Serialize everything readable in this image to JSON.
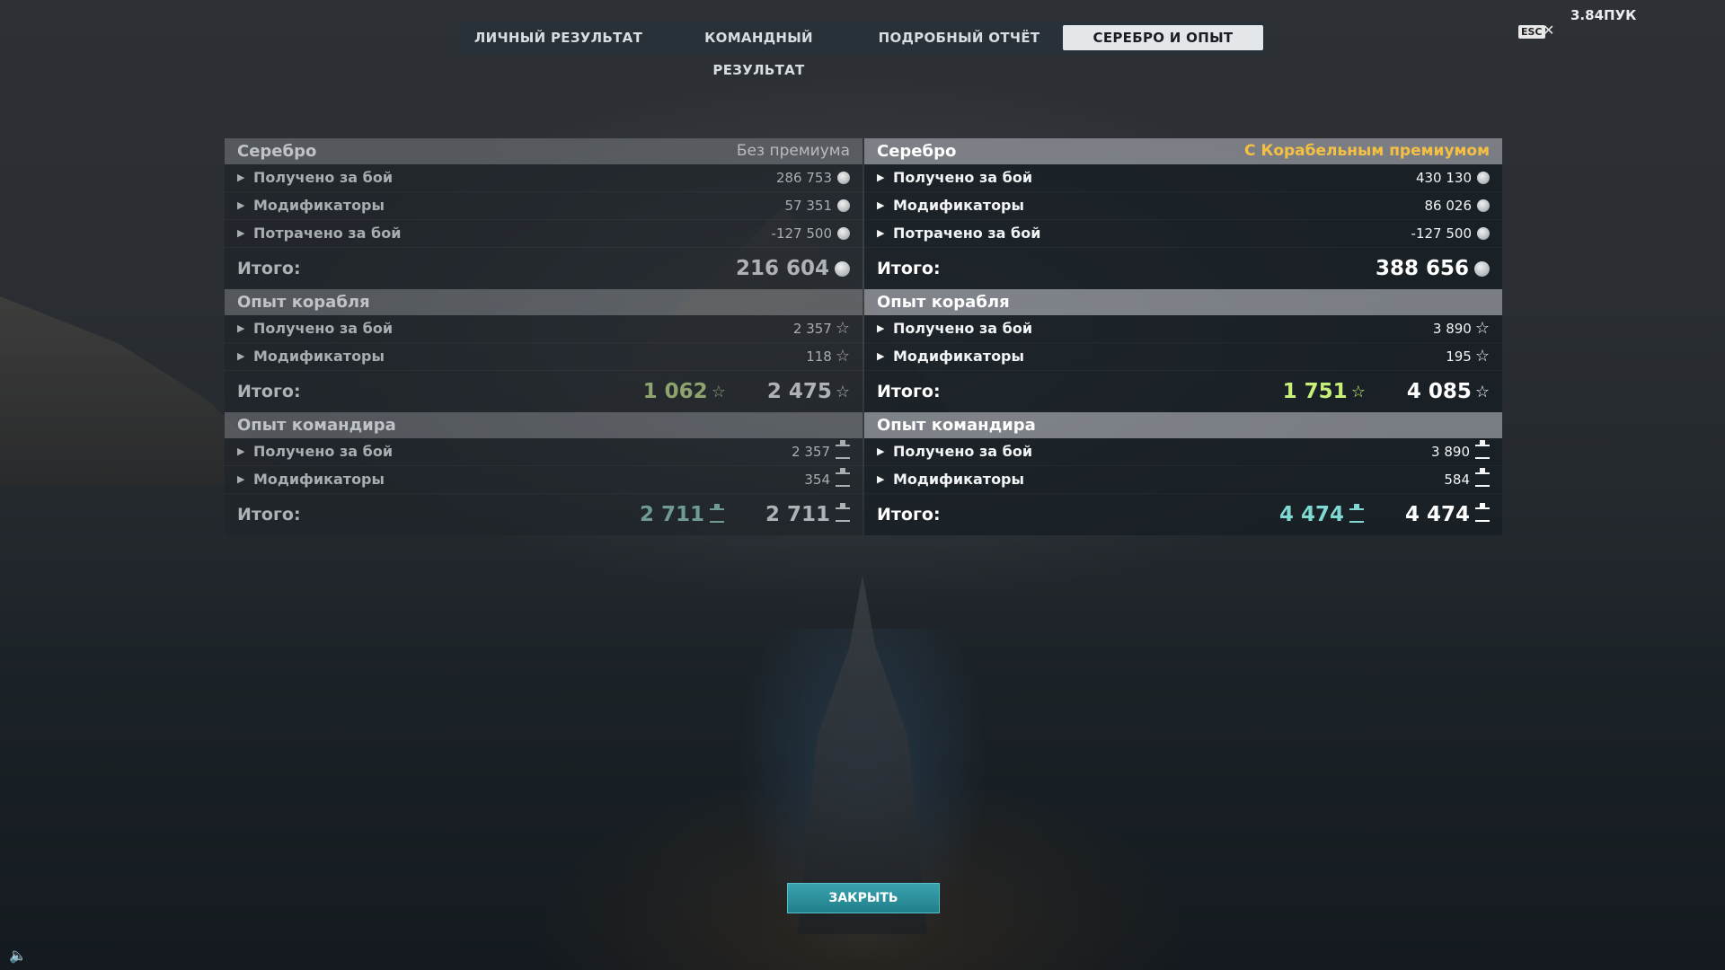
{
  "tabs": [
    {
      "label": "ЛИЧНЫЙ РЕЗУЛЬТАТ"
    },
    {
      "label": "КОМАНДНЫЙ РЕЗУЛЬТАТ"
    },
    {
      "label": "ПОДРОБНЫЙ ОТЧЁТ"
    },
    {
      "label": "СЕРЕБРО И ОПЫТ"
    }
  ],
  "active_tab": "СЕРЕБРО И ОПЫТ",
  "currency": "3.84ПУК",
  "esc_label": "ESC",
  "close_label": "ЗАКРЫТЬ",
  "left": {
    "premium_label": "Без премиума",
    "silver": {
      "title": "Серебро",
      "rows": [
        {
          "label": "Получено за бой",
          "value": "286 753"
        },
        {
          "label": "Модификаторы",
          "value": "57 351"
        },
        {
          "label": "Потрачено за бой",
          "value": "-127 500"
        }
      ],
      "total_label": "Итого:",
      "total": "216 604"
    },
    "ship_xp": {
      "title": "Опыт корабля",
      "rows": [
        {
          "label": "Получено за бой",
          "value": "2 357"
        },
        {
          "label": "Модификаторы",
          "value": "118"
        }
      ],
      "total_label": "Итого:",
      "free": "1 062",
      "total": "2 475"
    },
    "cmd_xp": {
      "title": "Опыт командира",
      "rows": [
        {
          "label": "Получено за бой",
          "value": "2 357"
        },
        {
          "label": "Модификаторы",
          "value": "354"
        }
      ],
      "total_label": "Итого:",
      "free": "2 711",
      "total": "2 711"
    }
  },
  "right": {
    "premium_label": "С Корабельным премиумом",
    "silver": {
      "title": "Серебро",
      "rows": [
        {
          "label": "Получено за бой",
          "value": "430 130"
        },
        {
          "label": "Модификаторы",
          "value": "86 026"
        },
        {
          "label": "Потрачено за бой",
          "value": "-127 500"
        }
      ],
      "total_label": "Итого:",
      "total": "388 656"
    },
    "ship_xp": {
      "title": "Опыт корабля",
      "rows": [
        {
          "label": "Получено за бой",
          "value": "3 890"
        },
        {
          "label": "Модификаторы",
          "value": "195"
        }
      ],
      "total_label": "Итого:",
      "free": "1 751",
      "total": "4 085"
    },
    "cmd_xp": {
      "title": "Опыт командира",
      "rows": [
        {
          "label": "Получено за бой",
          "value": "3 890"
        },
        {
          "label": "Модификаторы",
          "value": "584"
        }
      ],
      "total_label": "Итого:",
      "free": "4 474",
      "total": "4 474"
    }
  },
  "icons": {
    "silver": "silver-coin-icon",
    "ship_xp": "star-icon",
    "cmd_xp": "commander-xp-icon",
    "row_expand": "chevron-right-icon",
    "sound": "speaker-icon",
    "close_window": "close-icon"
  },
  "colors": {
    "premium": "#f5c042",
    "free_xp_green": "#c7f07a",
    "free_cmd_teal": "#7fd8d1",
    "close_button": "#1f7f8a"
  }
}
